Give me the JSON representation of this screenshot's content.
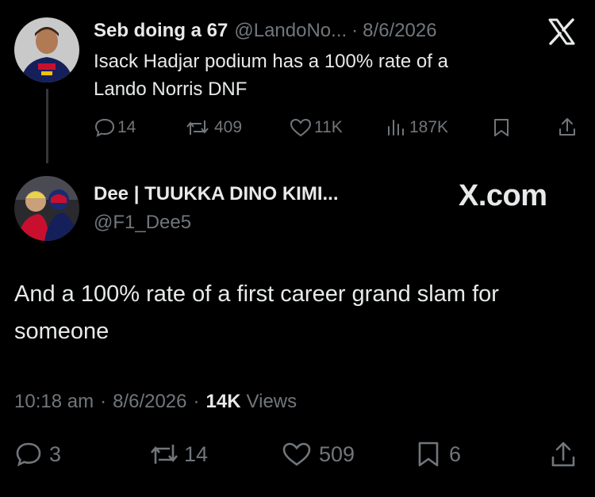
{
  "parent_tweet": {
    "display_name": "Seb doing a 67",
    "handle": "@LandoNo...",
    "separator": "·",
    "date": "8/6/2026",
    "text_line1": "Isack Hadjar podium has a 100% rate of a",
    "text_line2": "Lando Norris DNF",
    "actions": {
      "replies": "14",
      "reposts": "409",
      "likes": "11K",
      "views": "187K"
    }
  },
  "reply_tweet": {
    "display_name": "Dee | TUUKKA DINO KIMI...",
    "handle": "@F1_Dee5",
    "brand": "X.com",
    "text_line1": "And a 100% rate of a first career grand slam for",
    "text_line2": "someone",
    "time": "10:18 am",
    "separator1": "·",
    "date": "8/6/2026",
    "separator2": "·",
    "views_count": "14K",
    "views_label": "Views",
    "actions": {
      "replies": "3",
      "reposts": "14",
      "likes": "509",
      "bookmarks": "6"
    }
  },
  "colors": {
    "background": "#000000",
    "text": "#e7e9ea",
    "muted": "#71767b",
    "thread_line": "#333639"
  }
}
